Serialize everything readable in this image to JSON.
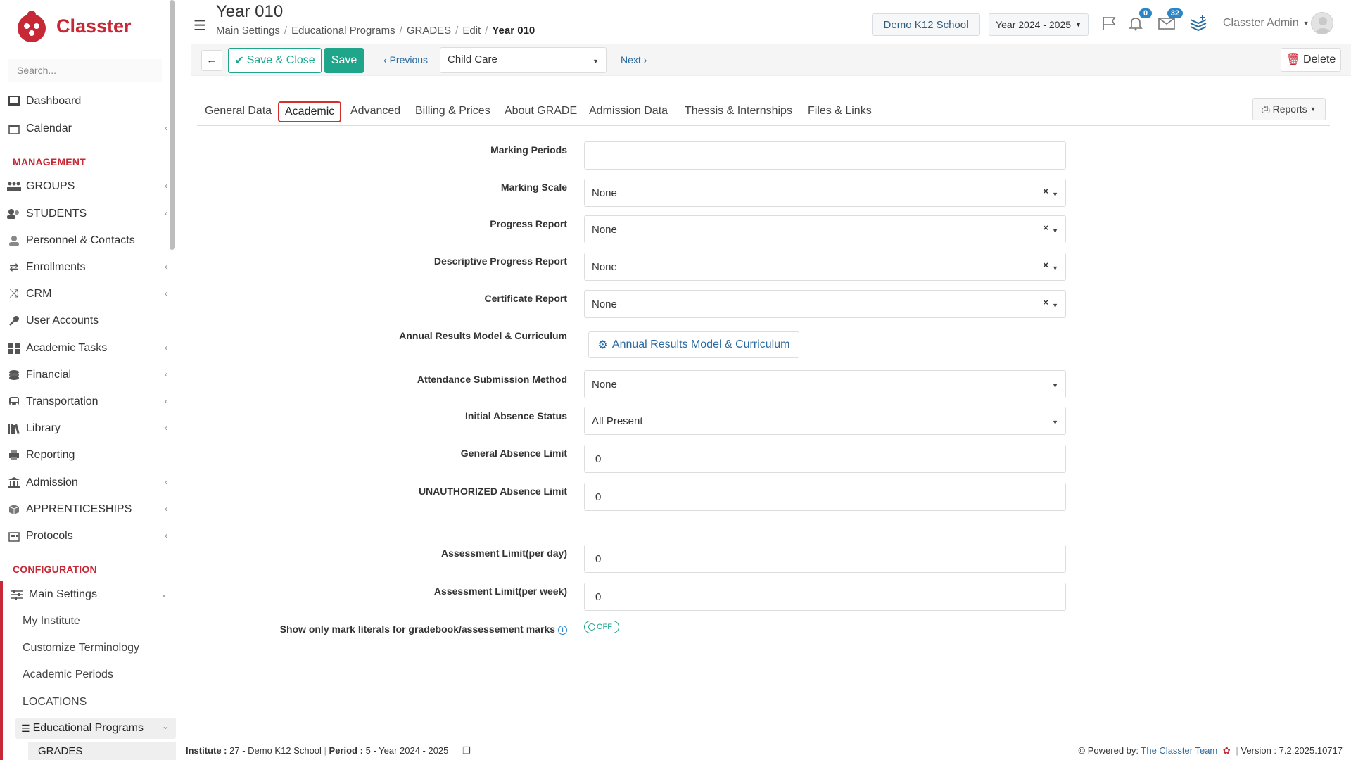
{
  "app": {
    "logo_text": "Classter",
    "brand_color": "#c62835",
    "accent_color": "#1fa58a"
  },
  "sidebar": {
    "search_placeholder": "Search...",
    "items": [
      {
        "label": "Dashboard",
        "icon": "laptop-icon"
      },
      {
        "label": "Calendar",
        "icon": "calendar-icon"
      },
      {
        "label": "GROUPS",
        "icon": "groups-icon"
      },
      {
        "label": "STUDENTS",
        "icon": "students-icon"
      },
      {
        "label": "Personnel & Contacts",
        "icon": "person-icon"
      },
      {
        "label": "Enrollments",
        "icon": "arrows-icon"
      },
      {
        "label": "CRM",
        "icon": "shuffle-icon"
      },
      {
        "label": "User Accounts",
        "icon": "key-icon"
      },
      {
        "label": "Academic Tasks",
        "icon": "grid-icon"
      },
      {
        "label": "Financial",
        "icon": "coins-icon"
      },
      {
        "label": "Transportation",
        "icon": "bus-icon"
      },
      {
        "label": "Library",
        "icon": "books-icon"
      },
      {
        "label": "Reporting",
        "icon": "print-icon"
      },
      {
        "label": "Admission",
        "icon": "building-icon"
      },
      {
        "label": "APPRENTICESHIPS",
        "icon": "box-icon"
      },
      {
        "label": "Protocols",
        "icon": "protocol-icon"
      }
    ],
    "section_management": "MANAGEMENT",
    "section_configuration": "CONFIGURATION",
    "main_settings": "Main Settings",
    "sub_items": [
      "My Institute",
      "Customize Terminology",
      "Academic Periods",
      "LOCATIONS"
    ],
    "educational_programs": "Educational Programs",
    "grades": "GRADES"
  },
  "header": {
    "title": "Year 010",
    "breadcrumb": [
      "Main Settings",
      "Educational Programs",
      "GRADES",
      "Edit",
      "Year 010"
    ],
    "school": "Demo K12 School",
    "year": "Year 2024 - 2025",
    "notifications_count": "0",
    "messages_count": "32",
    "user": "Classter Admin"
  },
  "toolbar": {
    "save_close": "Save & Close",
    "save": "Save",
    "previous": "Previous",
    "current": "Child Care",
    "next": "Next",
    "delete": "Delete"
  },
  "tabs": [
    "General Data",
    "Academic",
    "Advanced",
    "Billing & Prices",
    "About GRADE",
    "Admission Data",
    "Thessis & Internships",
    "Files & Links"
  ],
  "active_tab": "Academic",
  "reports": "Reports",
  "form": {
    "marking_periods": {
      "label": "Marking Periods",
      "value": ""
    },
    "marking_scale": {
      "label": "Marking Scale",
      "value": "None"
    },
    "progress_report": {
      "label": "Progress Report",
      "value": "None"
    },
    "descriptive_progress_report": {
      "label": "Descriptive Progress Report",
      "value": "None"
    },
    "certificate_report": {
      "label": "Certificate Report",
      "value": "None"
    },
    "annual_results": {
      "label": "Annual Results Model & Curriculum",
      "button": "Annual Results Model & Curriculum"
    },
    "attendance_method": {
      "label": "Attendance Submission Method",
      "value": "None"
    },
    "initial_absence": {
      "label": "Initial Absence Status",
      "value": "All Present"
    },
    "general_absence_limit": {
      "label": "General Absence Limit",
      "value": "0"
    },
    "unauthorized_absence_limit": {
      "label": "UNAUTHORIZED Absence Limit",
      "value": "0"
    },
    "assessment_limit_day": {
      "label": "Assessment Limit(per day)",
      "value": "0"
    },
    "assessment_limit_week": {
      "label": "Assessment Limit(per week)",
      "value": "0"
    },
    "mark_literals": {
      "label": "Show only mark literals for gradebook/assessement marks",
      "toggle": "OFF"
    }
  },
  "footer": {
    "institute_label": "Institute :",
    "institute_value": "27 - Demo K12 School",
    "period_label": "Period :",
    "period_value": "5 - Year 2024 - 2025",
    "powered_by": "Powered by:",
    "team": "The Classter Team",
    "version": "Version : 7.2.2025.10717"
  }
}
